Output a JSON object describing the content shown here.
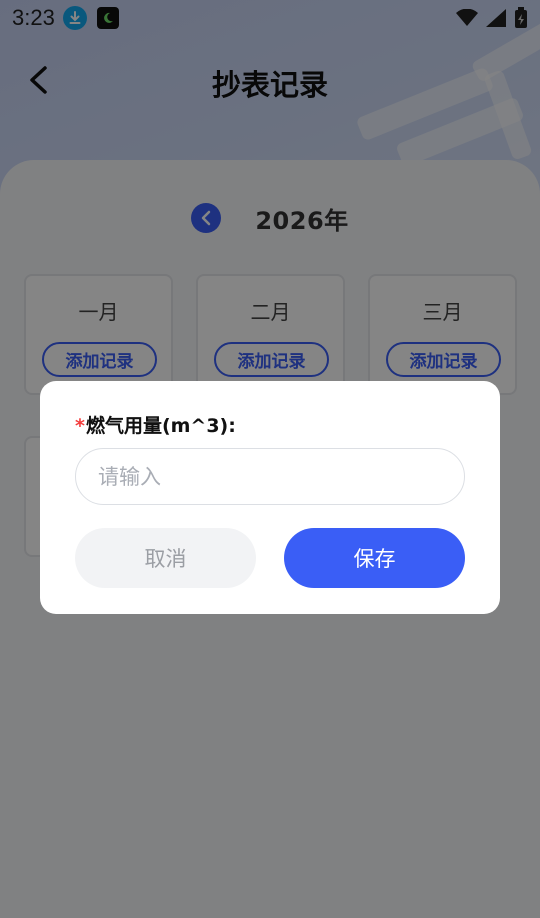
{
  "status_bar": {
    "time": "3:23",
    "icons": [
      "download-icon",
      "app-notification-icon",
      "wifi-icon",
      "signal-icon",
      "battery-icon"
    ]
  },
  "header": {
    "title": "抄表记录",
    "back_icon": "chevron-left-icon"
  },
  "year_selector": {
    "prev_icon": "chevron-left-icon",
    "year": "2026年"
  },
  "months": [
    {
      "name": "一月",
      "button": "添加记录"
    },
    {
      "name": "二月",
      "button": "添加记录"
    },
    {
      "name": "三月",
      "button": "添加记录"
    }
  ],
  "dialog": {
    "required_mark": "*",
    "field_label": "燃气用量(m^3):",
    "input_placeholder": "请输入",
    "input_value": "",
    "cancel_label": "取消",
    "save_label": "保存"
  },
  "colors": {
    "accent": "#3a5ef6",
    "required": "#f33b3b",
    "cancel_bg": "#f2f3f5"
  }
}
